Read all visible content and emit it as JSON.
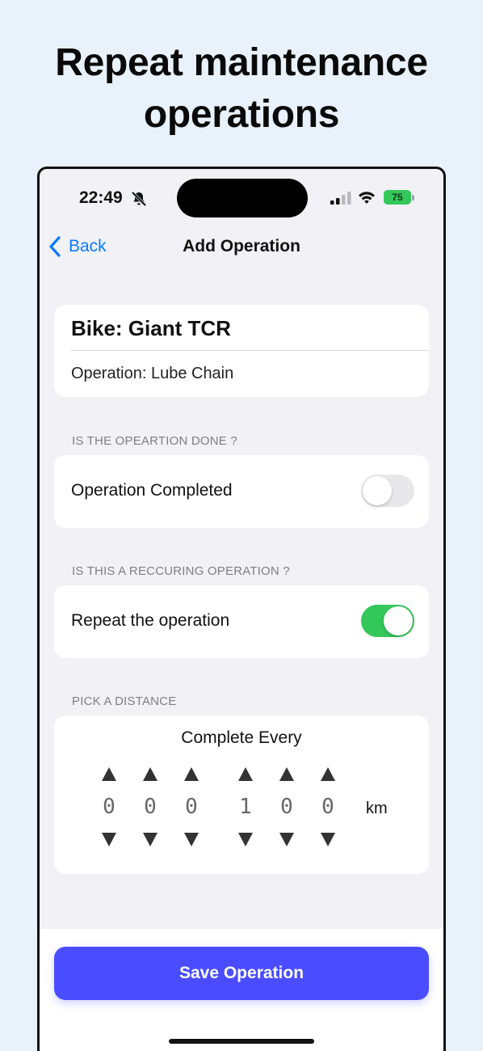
{
  "promo": {
    "title_line1": "Repeat maintenance",
    "title_line2": "operations"
  },
  "status_bar": {
    "time": "22:49",
    "battery_level": "75",
    "icons": [
      "bell-slash-icon",
      "cellular-signal-icon",
      "wifi-icon",
      "battery-icon"
    ]
  },
  "nav": {
    "back_label": "Back",
    "title": "Add Operation"
  },
  "bike_card": {
    "bike": "Bike: Giant TCR",
    "operation": "Operation: Lube Chain"
  },
  "done_section": {
    "header": "IS THE OPEARTION DONE ?",
    "label": "Operation Completed",
    "toggle_on": false
  },
  "recurring_section": {
    "header": "IS THIS A RECCURING OPERATION ?",
    "label": "Repeat the operation",
    "toggle_on": true
  },
  "distance_section": {
    "header": "PICK A DISTANCE",
    "title": "Complete Every",
    "digits": [
      "0",
      "0",
      "0",
      "1",
      "0",
      "0"
    ],
    "unit": "km"
  },
  "save_button": {
    "label": "Save Operation"
  },
  "colors": {
    "background": "#e9f1fb",
    "accent": "#4a4dff",
    "toggle_on": "#34c759",
    "link": "#0a7aff"
  }
}
